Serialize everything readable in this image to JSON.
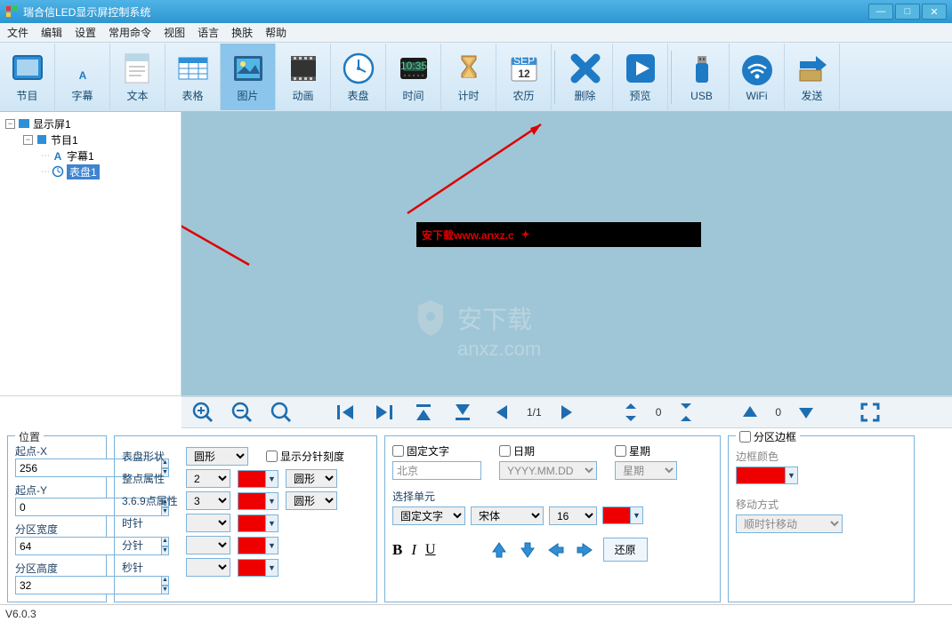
{
  "app_title": "瑞合信LED显示屏控制系统",
  "menu": [
    "文件",
    "编辑",
    "设置",
    "常用命令",
    "视图",
    "语言",
    "换肤",
    "帮助"
  ],
  "toolbar": [
    {
      "label": "节目",
      "icon": "program"
    },
    {
      "label": "字幕",
      "icon": "subtitle"
    },
    {
      "label": "文本",
      "icon": "text"
    },
    {
      "label": "表格",
      "icon": "table"
    },
    {
      "label": "图片",
      "icon": "image",
      "selected": true
    },
    {
      "label": "动画",
      "icon": "animation"
    },
    {
      "label": "表盘",
      "icon": "clock"
    },
    {
      "label": "时间",
      "icon": "time"
    },
    {
      "label": "计时",
      "icon": "timer"
    },
    {
      "label": "农历",
      "icon": "calendar"
    },
    {
      "label": "删除",
      "icon": "delete"
    },
    {
      "label": "预览",
      "icon": "preview"
    },
    {
      "label": "USB",
      "icon": "usb"
    },
    {
      "label": "WiFi",
      "icon": "wifi"
    },
    {
      "label": "发送",
      "icon": "send"
    }
  ],
  "tree": {
    "root": "显示屏1",
    "program": "节目1",
    "children": [
      "字幕1",
      "表盘1"
    ],
    "selected": "表盘1"
  },
  "preview_text": "安下载www.anxz.c",
  "watermark": {
    "line1": "安下载",
    "line2": "anxz.com"
  },
  "zoom": {
    "page": "1/1",
    "val1": "0",
    "val2": "0"
  },
  "position": {
    "title": "位置",
    "start_x_label": "起点-X",
    "start_x": "256",
    "start_y_label": "起点-Y",
    "start_y": "0",
    "width_label": "分区宽度",
    "width": "64",
    "height_label": "分区高度",
    "height": "32"
  },
  "shape": {
    "shape_label": "表盘形状",
    "shape_value": "圆形",
    "show_min_label": "显示分针刻度",
    "whole_label": "整点属性",
    "whole_value": "2",
    "whole_shape": "圆形",
    "q369_label": "3.6.9点属性",
    "q369_value": "3",
    "q369_shape": "圆形",
    "hour_label": "时针",
    "minute_label": "分针",
    "second_label": "秒针",
    "color_red": "#e00000"
  },
  "textpanel": {
    "fixed_text_label": "固定文字",
    "fixed_text_value": "北京",
    "date_label": "日期",
    "date_value": "YYYY.MM.DD",
    "week_label": "星期",
    "week_value": "星期",
    "select_unit_label": "选择单元",
    "unit_value": "固定文字",
    "font_value": "宋体",
    "size_value": "16",
    "restore_label": "还原"
  },
  "border": {
    "title": "分区边框",
    "color_label": "边框颜色",
    "move_label": "移动方式",
    "move_value": "顺时针移动"
  },
  "version": "V6.0.3"
}
